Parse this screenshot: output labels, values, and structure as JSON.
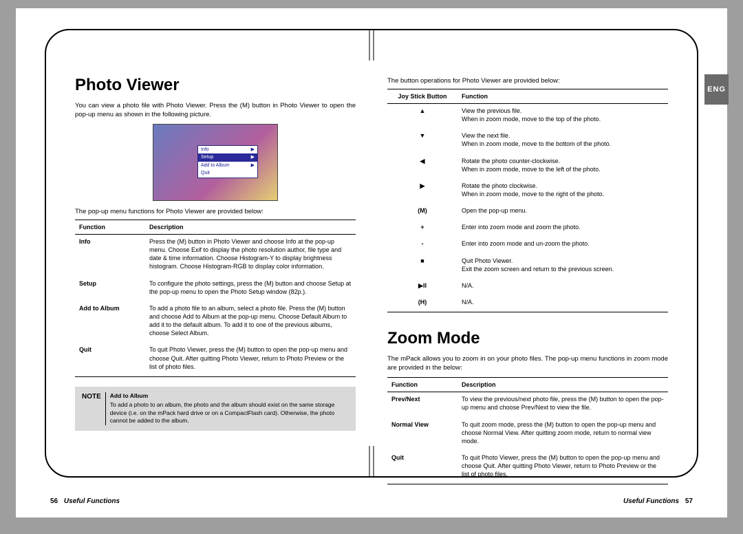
{
  "lang_tab": "ENG",
  "left": {
    "title": "Photo Viewer",
    "intro": "You can view a photo file with Photo Viewer. Press the (M) button in Photo Viewer to open the pop-up menu as shown in the following picture.",
    "fig_menu": [
      "Info",
      "Setup",
      "Add to Album",
      "Quit"
    ],
    "fig_sel_index": 1,
    "lead": "The pop-up menu functions for Photo Viewer are provided below:",
    "th1": "Function",
    "th2": "Description",
    "rows": [
      {
        "f": "Info",
        "d": "Press the (M) button in Photo Viewer and choose Info at the pop-up menu. Choose Exif to display the photo resolution author, file type and date & time information. Choose Histogram-Y to display brightness histogram. Choose Histogram-RGB to display color information."
      },
      {
        "f": "Setup",
        "d": "To configure the photo settings, press the (M) button and choose Setup at the pop-up menu to open the Photo Setup window (82p.)."
      },
      {
        "f": "Add to Album",
        "d": "To add a photo file to an album, select a photo file. Press the (M) button and choose Add to Album at the pop-up menu. Choose Default Album to add it to the default album. To add it to one of the previous albums, choose Select Album."
      },
      {
        "f": "Quit",
        "d": "To quit Photo Viewer, press the (M) button to open the pop-up menu and choose Quit. After quitting Photo Viewer, return to Photo Preview or the list of photo files."
      }
    ],
    "note_label": "NOTE",
    "note_title": "Add to Album",
    "note_body": "To add a photo to an album, the photo and the album should exist on the same storage device (i.e. on the mPack hard drive or on a CompactFlash card). Otherwise, the photo cannot be added to the album."
  },
  "right": {
    "lead1": "The button operations for Photo Viewer are provided below:",
    "th_joy": "Joy Stick Button",
    "th_func": "Function",
    "joy_rows": [
      {
        "s": "▲",
        "d": "View the previous file.\nWhen in zoom mode, move to the top of the photo."
      },
      {
        "s": "▼",
        "d": "View the next file.\nWhen in zoom mode, move to the bottom of the photo."
      },
      {
        "s": "◀",
        "d": "Rotate the photo counter-clockwise.\nWhen in zoom mode, move to the left of the photo."
      },
      {
        "s": "▶",
        "d": "Rotate the photo clockwise.\nWhen in zoom mode, move to the right of the photo."
      },
      {
        "s": "(M)",
        "d": "Open the pop-up menu."
      },
      {
        "s": "+",
        "d": "Enter into zoom mode and zoom the photo."
      },
      {
        "s": "-",
        "d": "Enter into zoom mode and un-zoom the photo."
      },
      {
        "s": "■",
        "d": "Quit Photo Viewer.\nExit the zoom screen and return to the previous screen."
      },
      {
        "s": "▶II",
        "d": "N/A."
      },
      {
        "s": "(H)",
        "d": "N/A."
      }
    ],
    "zoom_title": "Zoom Mode",
    "zoom_intro": "The mPack allows you to zoom in on your photo files. The pop-up menu functions in zoom mode are provided in the below:",
    "th1": "Function",
    "th2": "Description",
    "zoom_rows": [
      {
        "f": "Prev/Next",
        "d": "To view the previous/next photo file, press the (M) button to open the pop-up menu and choose Prev/Next to view the file."
      },
      {
        "f": "Normal View",
        "d": "To quit zoom mode, press the (M) button to open the pop-up menu and choose Normal View. After quitting zoom mode, return to normal view mode."
      },
      {
        "f": "Quit",
        "d": "To quit Photo Viewer, press the (M) button to open the pop-up menu and choose Quit. After quitting Photo Viewer, return to Photo Preview or the list of photo files."
      }
    ]
  },
  "footer": {
    "left_pn": "56",
    "left_title": "Useful Functions",
    "right_title": "Useful Functions",
    "right_pn": "57"
  }
}
